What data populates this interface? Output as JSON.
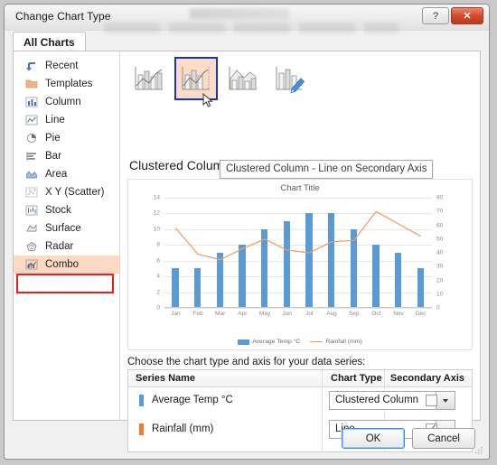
{
  "window": {
    "title": "Change Chart Type",
    "help_label": "?",
    "close_label": "✕"
  },
  "tabs": [
    {
      "label": "All Charts",
      "active": true
    }
  ],
  "sidebar": {
    "items": [
      {
        "label": "Recent",
        "icon": "recent-arrow-icon",
        "selected": false
      },
      {
        "label": "Templates",
        "icon": "folder-icon",
        "selected": false
      },
      {
        "label": "Column",
        "icon": "column-chart-icon",
        "selected": false
      },
      {
        "label": "Line",
        "icon": "line-chart-icon",
        "selected": false
      },
      {
        "label": "Pie",
        "icon": "pie-chart-icon",
        "selected": false
      },
      {
        "label": "Bar",
        "icon": "bar-chart-icon",
        "selected": false
      },
      {
        "label": "Area",
        "icon": "area-chart-icon",
        "selected": false
      },
      {
        "label": "X Y (Scatter)",
        "icon": "scatter-chart-icon",
        "selected": false
      },
      {
        "label": "Stock",
        "icon": "stock-chart-icon",
        "selected": false
      },
      {
        "label": "Surface",
        "icon": "surface-chart-icon",
        "selected": false
      },
      {
        "label": "Radar",
        "icon": "radar-chart-icon",
        "selected": false
      },
      {
        "label": "Combo",
        "icon": "combo-chart-icon",
        "selected": true
      }
    ],
    "highlight_color": "#ee1c1c",
    "selected_background": "#fbd9c3"
  },
  "chart_types": [
    {
      "name": "clustered-column-line",
      "selected": false
    },
    {
      "name": "clustered-column-line-on-secondary-axis",
      "selected": true
    },
    {
      "name": "stacked-area-clustered-column",
      "selected": false
    },
    {
      "name": "custom-combination",
      "selected": false
    }
  ],
  "preview": {
    "heading": "Clustered Colum",
    "tooltip": "Clustered Column - Line on Secondary Axis"
  },
  "chart_data": {
    "type": "bar",
    "title": "Chart Title",
    "xlabel": "",
    "ylabel": "",
    "categories": [
      "Jan",
      "Feb",
      "Mar",
      "Apr",
      "May",
      "Jun",
      "Jul",
      "Aug",
      "Sep",
      "Oct",
      "Nov",
      "Dec"
    ],
    "series": [
      {
        "name": "Average Temp °C",
        "type": "bar",
        "axis": "primary",
        "color": "#5b9bd5",
        "values": [
          5,
          5,
          7,
          8,
          10,
          11,
          12,
          12,
          10,
          8,
          7,
          5
        ]
      },
      {
        "name": "Rainfall (mm)",
        "type": "line",
        "axis": "secondary",
        "color": "#ed9b66",
        "values": [
          58,
          39,
          35,
          43,
          50,
          42,
          40,
          48,
          49,
          70,
          61,
          52
        ]
      }
    ],
    "ylim": [
      0,
      14
    ],
    "yticks": [
      0,
      2,
      4,
      6,
      8,
      10,
      12,
      14
    ],
    "y2lim": [
      0,
      80
    ],
    "y2ticks": [
      0,
      10,
      20,
      30,
      40,
      50,
      60,
      70,
      80
    ],
    "grid": true,
    "legend": "bottom",
    "legend_entries": [
      "Average Temp °C",
      "Rainfall (mm)"
    ]
  },
  "series_table": {
    "caption": "Choose the chart type and axis for your data series:",
    "headers": [
      "Series Name",
      "Chart Type",
      "Secondary Axis"
    ],
    "rows": [
      {
        "series_name": "Average Temp °C",
        "swatch_color": "#5b9bd5",
        "chart_type": "Clustered Column",
        "secondary_axis": false
      },
      {
        "series_name": "Rainfall (mm)",
        "swatch_color": "#ed7d31",
        "chart_type": "Line",
        "secondary_axis": true
      }
    ],
    "checkmark": "✓"
  },
  "footer": {
    "ok_label": "OK",
    "cancel_label": "Cancel"
  }
}
